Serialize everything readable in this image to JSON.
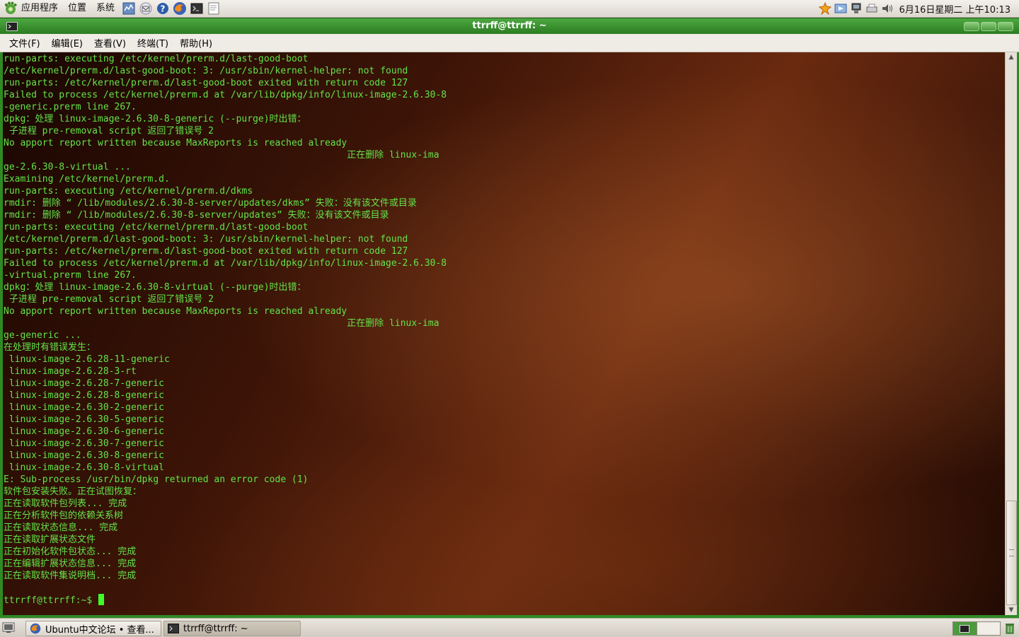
{
  "top_panel": {
    "menus": [
      "应用程序",
      "位置",
      "系统"
    ],
    "launchers": [
      "system-monitor-icon",
      "mail-icon",
      "help-icon",
      "firefox-icon",
      "terminal-icon",
      "editor-icon"
    ],
    "tray": [
      "notification-icon",
      "update-icon",
      "network-icon",
      "printer-icon",
      "volume-icon"
    ],
    "clock": "6月16日星期二 上午10:13"
  },
  "window": {
    "title": "ttrrff@ttrrff: ~",
    "menu": [
      "文件(F)",
      "编辑(E)",
      "查看(V)",
      "终端(T)",
      "帮助(H)"
    ]
  },
  "terminal": {
    "lines": [
      "run-parts: executing /etc/kernel/prerm.d/last-good-boot",
      "/etc/kernel/prerm.d/last-good-boot: 3: /usr/sbin/kernel-helper: not found",
      "run-parts: /etc/kernel/prerm.d/last-good-boot exited with return code 127",
      "Failed to process /etc/kernel/prerm.d at /var/lib/dpkg/info/linux-image-2.6.30-8",
      "-generic.prerm line 267.",
      "dpkg：处理 linux-image-2.6.30-8-generic (--purge)时出错：",
      " 子进程 pre-removal script 返回了错误号 2",
      "No apport report written because MaxReports is reached already",
      "                                                              正在删除 linux-ima",
      "ge-2.6.30-8-virtual ...",
      "Examining /etc/kernel/prerm.d.",
      "run-parts: executing /etc/kernel/prerm.d/dkms",
      "rmdir: 删除 “ /lib/modules/2.6.30-8-server/updates/dkms” 失败：没有该文件或目录",
      "rmdir: 删除 “ /lib/modules/2.6.30-8-server/updates” 失败：没有该文件或目录",
      "run-parts: executing /etc/kernel/prerm.d/last-good-boot",
      "/etc/kernel/prerm.d/last-good-boot: 3: /usr/sbin/kernel-helper: not found",
      "run-parts: /etc/kernel/prerm.d/last-good-boot exited with return code 127",
      "Failed to process /etc/kernel/prerm.d at /var/lib/dpkg/info/linux-image-2.6.30-8",
      "-virtual.prerm line 267.",
      "dpkg：处理 linux-image-2.6.30-8-virtual (--purge)时出错：",
      " 子进程 pre-removal script 返回了错误号 2",
      "No apport report written because MaxReports is reached already",
      "                                                              正在删除 linux-ima",
      "ge-generic ...",
      "在处理时有错误发生：",
      " linux-image-2.6.28-11-generic",
      " linux-image-2.6.28-3-rt",
      " linux-image-2.6.28-7-generic",
      " linux-image-2.6.28-8-generic",
      " linux-image-2.6.30-2-generic",
      " linux-image-2.6.30-5-generic",
      " linux-image-2.6.30-6-generic",
      " linux-image-2.6.30-7-generic",
      " linux-image-2.6.30-8-generic",
      " linux-image-2.6.30-8-virtual",
      "E: Sub-process /usr/bin/dpkg returned an error code (1)",
      "软件包安装失败。正在试图恢复：",
      "正在读取软件包列表... 完成",
      "正在分析软件包的依赖关系树",
      "正在读取状态信息... 完成",
      "正在读取扩展状态文件",
      "正在初始化软件包状态... 完成",
      "正在编辑扩展状态信息... 完成",
      "正在读取软件集说明档... 完成",
      ""
    ],
    "prompt": "ttrrff@ttrrff:~$ ",
    "text_color": "#63e34a"
  },
  "bottom_panel": {
    "tasks": [
      {
        "label": "Ubuntu中文论坛 • 查看...",
        "icon": "firefox-icon"
      },
      {
        "label": "ttrrff@ttrrff: ~",
        "icon": "terminal-icon"
      }
    ]
  }
}
